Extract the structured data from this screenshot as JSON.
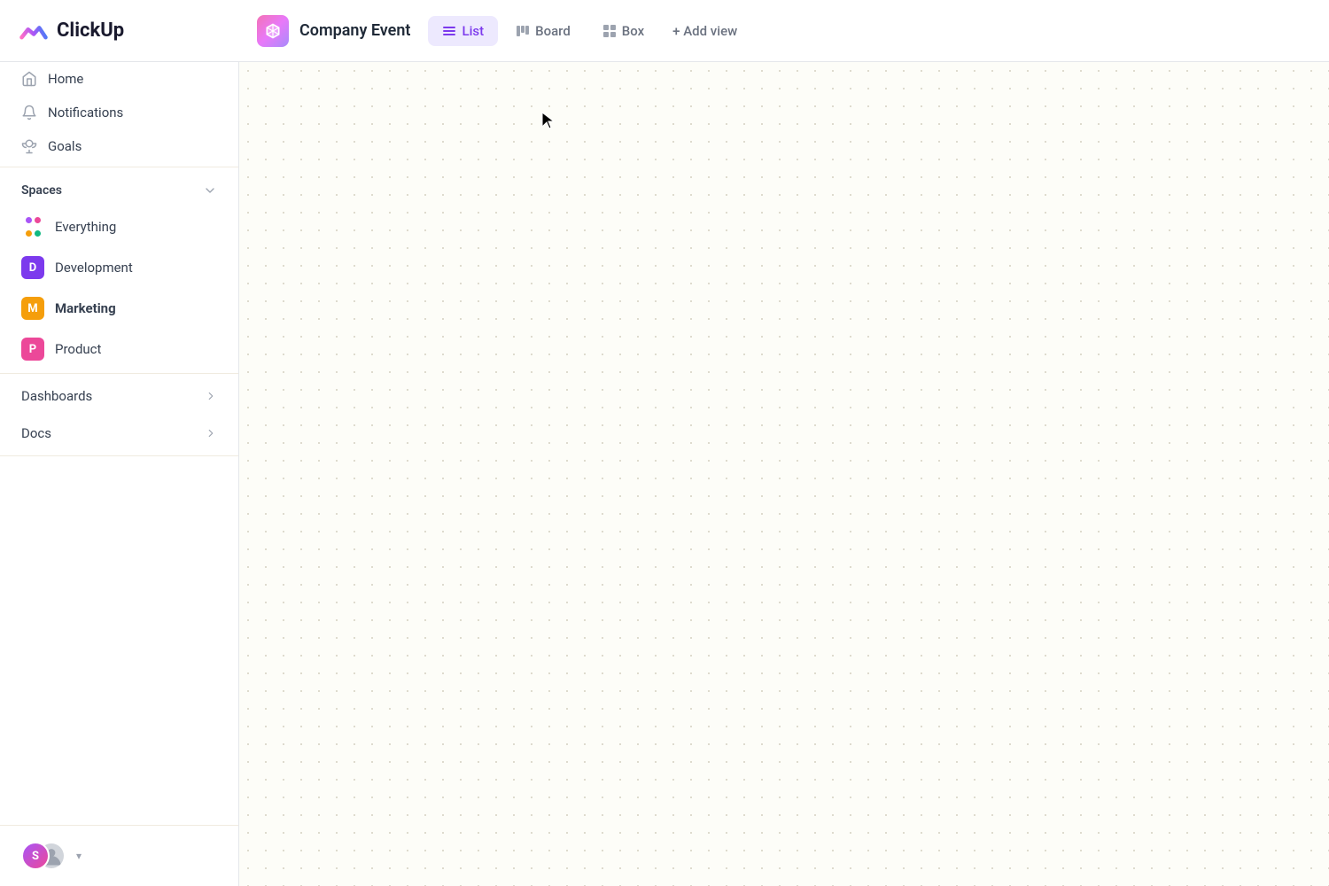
{
  "logo": {
    "text": "ClickUp"
  },
  "header": {
    "project_name": "Company Event",
    "tabs": [
      {
        "id": "list",
        "label": "List",
        "active": true
      },
      {
        "id": "board",
        "label": "Board",
        "active": false
      },
      {
        "id": "box",
        "label": "Box",
        "active": false
      }
    ],
    "add_view_label": "+ Add view"
  },
  "sidebar": {
    "nav_items": [
      {
        "id": "home",
        "label": "Home",
        "icon": "home-icon"
      },
      {
        "id": "notifications",
        "label": "Notifications",
        "icon": "bell-icon"
      },
      {
        "id": "goals",
        "label": "Goals",
        "icon": "trophy-icon"
      }
    ],
    "spaces_label": "Spaces",
    "spaces": [
      {
        "id": "everything",
        "label": "Everything",
        "type": "everything"
      },
      {
        "id": "development",
        "label": "Development",
        "type": "avatar",
        "letter": "D",
        "color": "#7c3aed"
      },
      {
        "id": "marketing",
        "label": "Marketing",
        "type": "avatar",
        "letter": "M",
        "color": "#f59e0b",
        "bold": true
      },
      {
        "id": "product",
        "label": "Product",
        "type": "avatar",
        "letter": "P",
        "color": "#ec4899"
      }
    ],
    "expandable_items": [
      {
        "id": "dashboards",
        "label": "Dashboards"
      },
      {
        "id": "docs",
        "label": "Docs"
      }
    ],
    "dots_colors": [
      "#a855f7",
      "#ec4899",
      "#f59e0b",
      "#10b981"
    ],
    "user_initial": "S"
  }
}
